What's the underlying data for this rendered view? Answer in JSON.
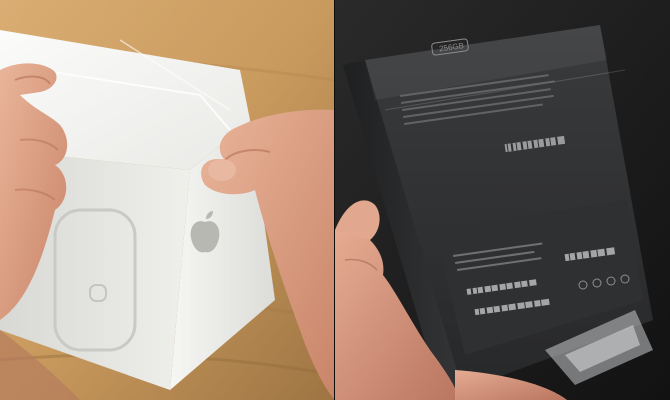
{
  "photo": {
    "left_scene": "unwrapping-box",
    "right_scene": "box-back-in-hand"
  },
  "box_back": {
    "capacity_label": "256GB"
  },
  "colors": {
    "wood": "#c99a5e",
    "box_white": "#f4f4f2",
    "skin": "#e0a58a",
    "box_dark": "#2e2f31",
    "background_dark": "#1c1c1c"
  }
}
